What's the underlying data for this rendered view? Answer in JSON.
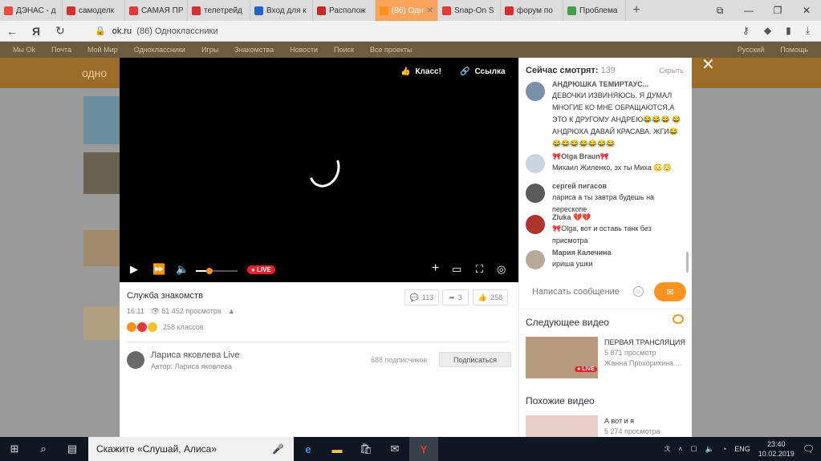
{
  "browser": {
    "tabs": [
      {
        "label": "ДЭНАС - д",
        "color": "#e74c3c"
      },
      {
        "label": "самоделк",
        "color": "#d32f2f"
      },
      {
        "label": "САМАЯ ПР",
        "color": "#e53935"
      },
      {
        "label": "телетрейд",
        "color": "#d32f2f"
      },
      {
        "label": "Вход для к",
        "color": "#1e64c8"
      },
      {
        "label": "Располож",
        "color": "#c62828"
      },
      {
        "label": "(86) Одн",
        "color": "#f7931e"
      },
      {
        "label": "Snap-On S",
        "color": "#e53935"
      },
      {
        "label": "форум по",
        "color": "#d32f2f"
      },
      {
        "label": "Проблема",
        "color": "#43a047"
      }
    ],
    "active_tab": 6,
    "url_domain": "ok.ru",
    "url_title": "(86) Одноклассники"
  },
  "site_nav": [
    "Мы Ok",
    "Почта",
    "Мой Мир",
    "Одноклассники",
    "Игры",
    "Знакомства",
    "Новости",
    "Поиск",
    "Все проекты",
    "Русский",
    "Помощь"
  ],
  "site_logo": "одно",
  "video": {
    "class_label": "Класс!",
    "link_label": "Ссылка",
    "live_label": "LIVE",
    "title": "Служба  знакомств",
    "time": "16:11",
    "views": "81 452 просмотра",
    "comments": "113",
    "shares": "3",
    "likes": "258",
    "reactions_label": "258 классов",
    "author_name": "Лариса яковлева Live",
    "author_line": "Автор: Лариса яковлева",
    "subscribers": "688 подписчиков",
    "subscribe_label": "Подписаться"
  },
  "chat": {
    "title": "Сейчас смотрят:",
    "count": "139",
    "hide_label": "Скрыть",
    "messages": [
      {
        "name": "АНДРЮШКА ТЕМИРТАУС...",
        "text": "ДЕВОЧКИ ИЗВИНЯЮСЬ. Я ДУМАЛ МНОГИЕ КО МНЕ ОБРАЩАЮТСЯ,А ЭТО К ДРУГОМУ АНДРЕЮ😂😂😂 😂АНДРЮХА ДАВАЙ КРАСАВА. ЖГИ😂😂😂😂😂😂😂😂",
        "avatar": "#7a8fa8"
      },
      {
        "name": "🎀Olga Braun🎀",
        "text": "Михаил Жиленко, эх ты Миха 😳😳",
        "avatar": "#c8d4e0"
      },
      {
        "name": "сергей пигасов",
        "text": "лариса а ты завтра будешь на перескопе",
        "avatar": "#5a5a5a"
      },
      {
        "name": "Zluka 💔💔",
        "text": "🎀Olga, вот и оставь танк без присмотра",
        "avatar": "#b0342e"
      },
      {
        "name": "Мария Калечина",
        "text": "ириша ушки",
        "avatar": "#b8a898"
      }
    ],
    "input_placeholder": "Написать сообщение"
  },
  "next": {
    "title": "Следующее видео",
    "video_title": "ПЕРВАЯ ТРАНСЛЯЦИЯ",
    "views": "5 871 просмотр",
    "author": "Жанна Прохорихина ...",
    "live": "LIVE"
  },
  "similar": {
    "title": "Похожие видео",
    "video_title": "А вот и я",
    "views": "5 274 просмотра"
  },
  "taskbar": {
    "search_text": "Скажите «Слушай, Алиса»",
    "lang": "ENG",
    "time": "23:40",
    "date": "10.02.2019"
  }
}
